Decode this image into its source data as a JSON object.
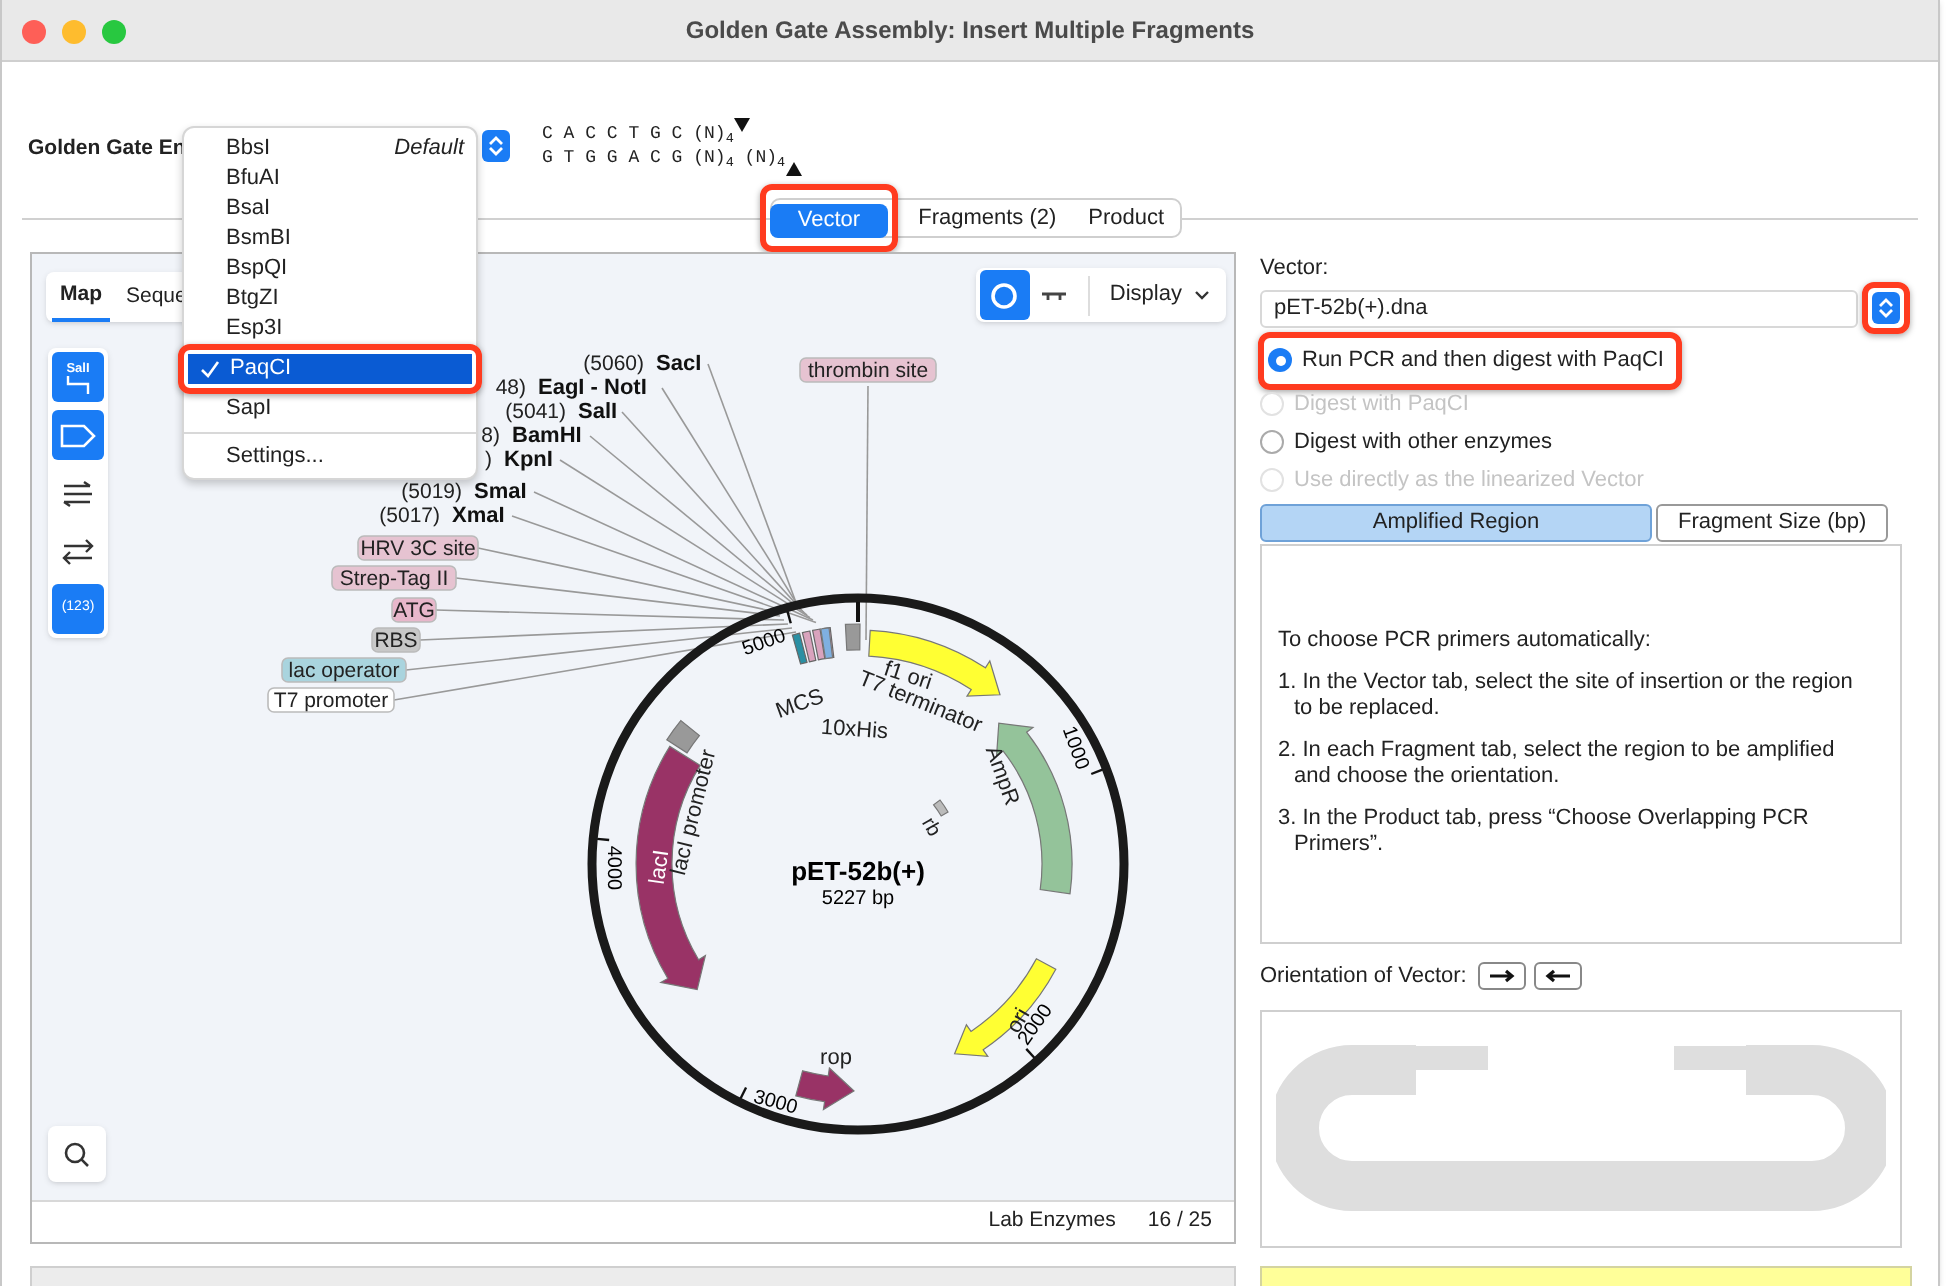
{
  "window": {
    "title": "Golden Gate Assembly: Insert Multiple Fragments"
  },
  "enzyme_row": {
    "label": "Golden Gate En",
    "site_top": "C A C C T G C (N)$_{4}$",
    "site_bottom": "G T G G A C G (N)$_{4}$ (N)$_{4}$"
  },
  "enzyme_menu": {
    "items": [
      {
        "label": "BbsI",
        "note": "Default",
        "selected": false,
        "highlighted": false
      },
      {
        "label": "BfuAI",
        "selected": false,
        "highlighted": false
      },
      {
        "label": "BsaI",
        "selected": false,
        "highlighted": false
      },
      {
        "label": "BsmBI",
        "selected": false,
        "highlighted": false
      },
      {
        "label": "BspQI",
        "selected": false,
        "highlighted": false
      },
      {
        "label": "BtgZI",
        "selected": false,
        "highlighted": false
      },
      {
        "label": "Esp3I",
        "selected": false,
        "highlighted": false
      },
      {
        "label": "PaqCI",
        "selected": true,
        "highlighted": true
      },
      {
        "label": "SapI",
        "selected": false,
        "highlighted": false
      }
    ],
    "settings": "Settings..."
  },
  "main_tabs": [
    {
      "label": "Vector",
      "selected": true,
      "highlighted": true
    },
    {
      "label": "Fragments (2)",
      "selected": false,
      "highlighted": false
    },
    {
      "label": "Product",
      "selected": false,
      "highlighted": false
    }
  ],
  "map_panel": {
    "view_tabs": [
      {
        "label": "Map",
        "selected": true
      },
      {
        "label": "Seque",
        "selected": false
      }
    ],
    "tools": [
      {
        "kind": "enzymes",
        "label": "SalI",
        "active": true
      },
      {
        "kind": "features",
        "active": true
      },
      {
        "kind": "orfs",
        "active": false
      },
      {
        "kind": "primers",
        "active": false
      },
      {
        "kind": "numbers",
        "label": "(123)",
        "active": true
      }
    ],
    "view_modes": [
      {
        "kind": "circular",
        "selected": true
      },
      {
        "kind": "linear",
        "selected": false
      }
    ],
    "display_button": "Display",
    "enzyme_labels": [
      {
        "position": "(5060)",
        "name": "SacI"
      },
      {
        "position": "48)",
        "name": "EagI - NotI"
      },
      {
        "position": "(5041)",
        "name": "SalI"
      },
      {
        "position": "8)",
        "name": "BamHI"
      },
      {
        "position": ")",
        "name": "KpnI"
      },
      {
        "position": "(5019)",
        "name": "SmaI"
      },
      {
        "position": "(5017)",
        "name": "XmaI"
      }
    ],
    "feature_labels": [
      {
        "label": "thrombin site",
        "color": "#e6c3d1"
      },
      {
        "label": "HRV 3C site",
        "color": "#e6c3d1"
      },
      {
        "label": "Strep-Tag II",
        "color": "#e6c3d1"
      },
      {
        "label": "ATG",
        "color": "#e8b7cb"
      },
      {
        "label": "RBS",
        "color": "#c8c8c8"
      },
      {
        "label": "lac operator",
        "color": "#a9d4de"
      },
      {
        "label": "T7 promoter",
        "color": "#ffffff"
      }
    ],
    "map": {
      "name": "pET-52b(+)",
      "size": "5227 bp",
      "ticks": [
        "1000",
        "2000",
        "3000",
        "4000",
        "5000"
      ],
      "features": [
        {
          "label": "f1 ori",
          "color": "#ffff33"
        },
        {
          "label": "T7 terminator",
          "color": "#999999"
        },
        {
          "label": "MCS",
          "color": "#d9a3bd"
        },
        {
          "label": "10xHis",
          "color": "#7fb0e0"
        },
        {
          "label": "AmpR",
          "color": "#94c39a"
        },
        {
          "label": "ori",
          "color": "#ffff33"
        },
        {
          "label": "rop",
          "color": "#993366"
        },
        {
          "label": "lacI",
          "color": "#993366"
        },
        {
          "label": "lacI promoter",
          "color": "#999999"
        },
        {
          "label": "rb",
          "color": "#bbbbbb"
        }
      ]
    },
    "status": {
      "enzyme_set": "Lab Enzymes",
      "count": "16 / 25"
    }
  },
  "vector_panel": {
    "label": "Vector:",
    "value": "pET-52b(+).dna",
    "stepper_highlighted": true,
    "options": [
      {
        "label": "Run PCR and then digest with PaqCI",
        "selected": true,
        "disabled": false,
        "highlighted": true
      },
      {
        "label": "Digest with PaqCI",
        "selected": false,
        "disabled": true,
        "highlighted": false
      },
      {
        "label": "Digest with other enzymes",
        "selected": false,
        "disabled": false,
        "highlighted": false
      },
      {
        "label": "Use directly as the linearized Vector",
        "selected": false,
        "disabled": true,
        "highlighted": false
      }
    ],
    "segments": [
      {
        "label": "Amplified Region",
        "selected": true
      },
      {
        "label": "Fragment Size (bp)",
        "selected": false
      }
    ],
    "instructions": {
      "intro": "To choose PCR primers automatically:",
      "steps": [
        "1. In the Vector tab, select the site of insertion or the region to be replaced.",
        "2. In each Fragment tab, select the region to be amplified and choose the orientation.",
        "3. In the Product tab, press “Choose Overlapping PCR Primers”."
      ]
    },
    "orientation": {
      "label": "Orientation of Vector:",
      "buttons": [
        {
          "kind": "forward"
        },
        {
          "kind": "reverse"
        }
      ]
    }
  }
}
